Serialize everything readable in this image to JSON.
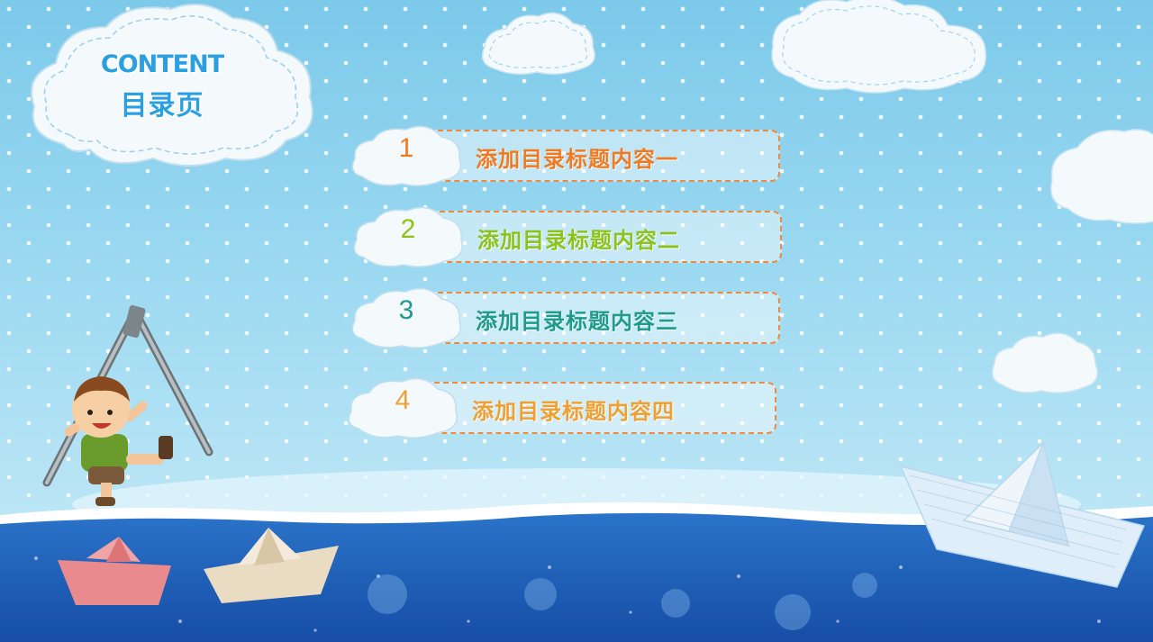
{
  "title": {
    "en": "CONTENT",
    "cn": "目录页"
  },
  "toc": [
    {
      "number": "1",
      "label": "添加目录标题内容一",
      "color": "#ef7a22"
    },
    {
      "number": "2",
      "label": "添加目录标题内容二",
      "color": "#8cc21a"
    },
    {
      "number": "3",
      "label": "添加目录标题内容三",
      "color": "#1e9b8a"
    },
    {
      "number": "4",
      "label": "添加目录标题内容四",
      "color": "#f0a030"
    }
  ],
  "colors": {
    "sky": "#8fd3ee",
    "sea": "#1f5fb8",
    "accent_border": "#ef8a3c",
    "title": "#2c9fe0"
  }
}
